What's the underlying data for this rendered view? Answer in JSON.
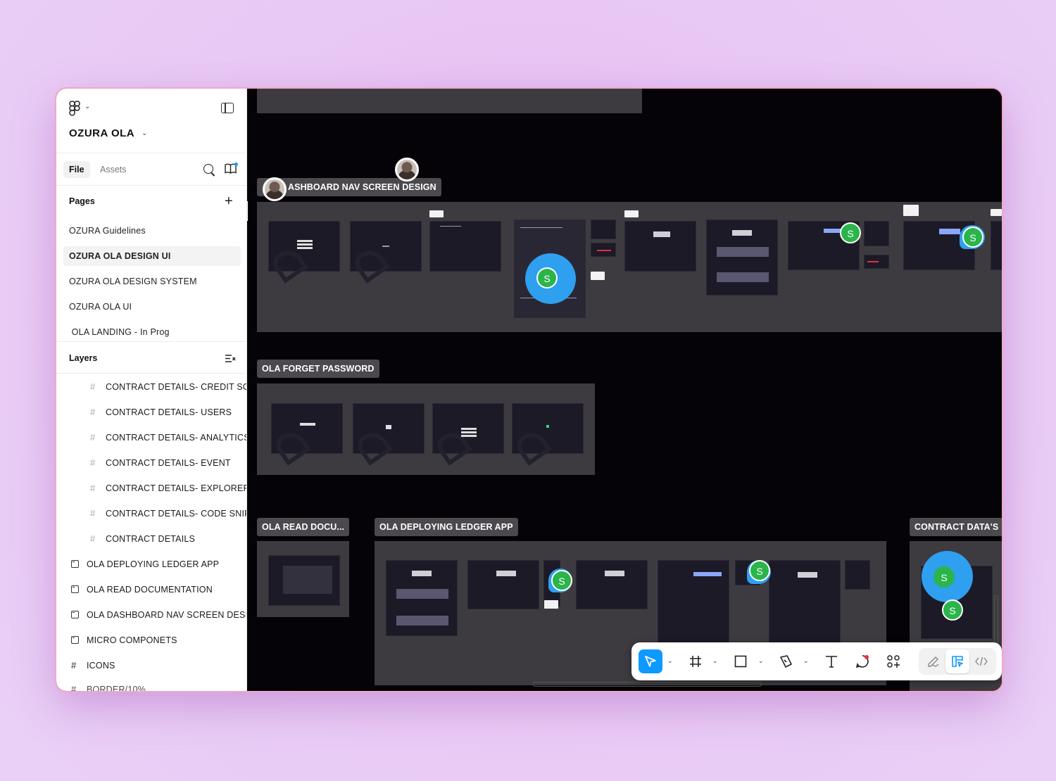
{
  "project": {
    "name": "OZURA OLA"
  },
  "tabs": {
    "file": "File",
    "assets": "Assets"
  },
  "pages": {
    "heading": "Pages",
    "items": [
      {
        "label": "OZURA  Guidelines"
      },
      {
        "label": "OZURA OLA DESIGN UI",
        "active": true
      },
      {
        "label": "OZURA OLA DESIGN SYSTEM"
      },
      {
        "label": "OZURA OLA UI"
      },
      {
        "label": " OLA LANDING - In Prog"
      }
    ]
  },
  "layers": {
    "heading": "Layers",
    "items": [
      {
        "label": "CONTRACT DETAILS- CREDIT SCORE",
        "type": "frame-child"
      },
      {
        "label": "CONTRACT DETAILS- USERS",
        "type": "frame-child"
      },
      {
        "label": "CONTRACT DETAILS- ANALYTICS",
        "type": "frame-child"
      },
      {
        "label": "CONTRACT DETAILS- EVENT",
        "type": "frame-child"
      },
      {
        "label": "CONTRACT DETAILS- EXPLORER",
        "type": "frame-child"
      },
      {
        "label": "CONTRACT DETAILS- CODE SNIPPET",
        "type": "frame-child"
      },
      {
        "label": "CONTRACT DETAILS",
        "type": "frame-child"
      },
      {
        "label": "OLA DEPLOYING LEDGER APP",
        "type": "section"
      },
      {
        "label": "OLA READ DOCUMENTATION",
        "type": "section"
      },
      {
        "label": "OLA DASHBOARD NAV SCREEN DESIGN",
        "type": "section"
      },
      {
        "label": "MICRO COMPONETS",
        "type": "section"
      },
      {
        "label": "ICONS",
        "type": "frame"
      },
      {
        "label": "BORDER/10%",
        "type": "frame"
      }
    ]
  },
  "canvas": {
    "sections": {
      "dashboard": "ASHBOARD NAV SCREEN DESIGN",
      "forget": "OLA FORGET PASSWORD",
      "read_docs": "OLA READ DOCU...",
      "deploying": "OLA DEPLOYING LEDGER APP",
      "contract": "CONTRACT DATA'S"
    },
    "collaborator_initial": "S"
  },
  "toolbar": {
    "tools": [
      "move-tool",
      "frame-tool",
      "rectangle-tool",
      "pen-tool",
      "text-tool",
      "comment-tool",
      "actions-tool",
      "draw-mode",
      "design-mode",
      "dev-mode"
    ],
    "active_tool": "move-tool"
  },
  "colors": {
    "accent": "#0d99ff",
    "collaborator": "#2bb44a",
    "canvas": "#050307",
    "section": "#3d3b3f",
    "window_border": "#f4a6c8"
  }
}
